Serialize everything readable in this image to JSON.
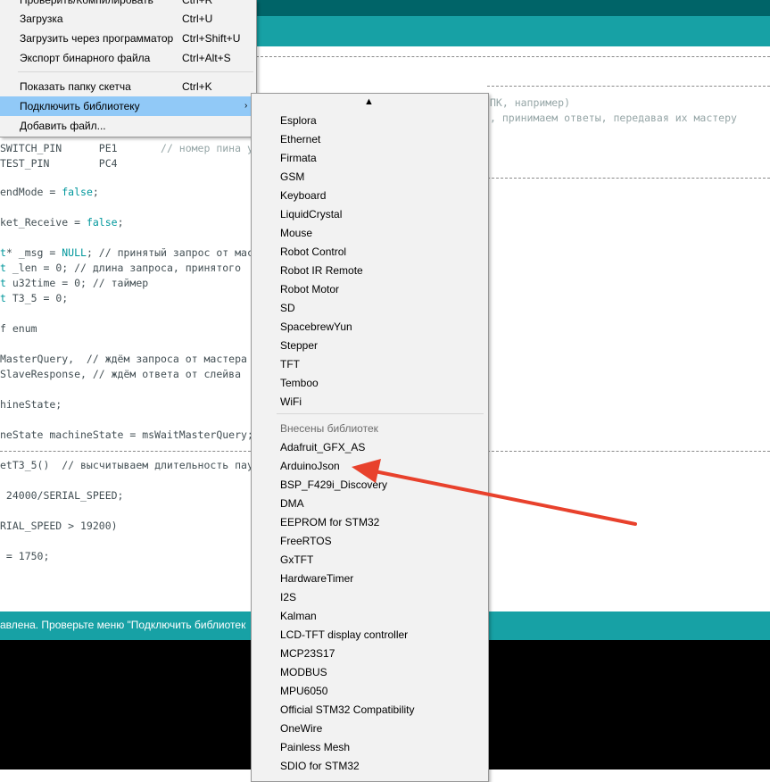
{
  "editor": {
    "lines": [
      [
        "",
        "SWITCH_PIN      PE1       ",
        "",
        "// номер пина у"
      ],
      [
        "",
        "TEST_PIN        PC4",
        "",
        ""
      ],
      [
        "",
        "endMode = ",
        "false",
        ";"
      ],
      [
        "",
        "ket_Receive = ",
        "false",
        ";"
      ],
      [
        "t",
        "* _msg = ",
        "NULL",
        "; // принятый запрос от мас"
      ],
      [
        "t",
        " _len = 0; // длина запроса, принятого",
        "",
        ""
      ],
      [
        "t",
        " u32time = 0; // таймер",
        "",
        ""
      ],
      [
        "t",
        " T3_5 = 0;",
        "",
        ""
      ],
      [
        "",
        "f enum",
        "",
        ""
      ],
      [
        "",
        "MasterQuery,  // ждём запроса от мастера",
        "",
        ""
      ],
      [
        "",
        "SlaveResponse, // ждём ответа от слейва",
        "",
        ""
      ],
      [
        "",
        "hineState;",
        "",
        ""
      ],
      [
        "",
        "neState machineState = msWaitMasterQuery;",
        "",
        ""
      ],
      [
        "",
        "etT3_5()  // высчитываем длительность пау",
        "",
        ""
      ],
      [
        "",
        " 24000/SERIAL_SPEED;",
        "",
        ""
      ],
      [
        "",
        "RIAL_SPEED > 19200)",
        "",
        ""
      ],
      [
        "",
        " = 1750;",
        "",
        ""
      ]
    ],
    "right_comment_1": "ПК, например)",
    "right_comment_2": ", принимаем ответы, передавая их мастеру"
  },
  "status_bar": {
    "text": "авлена. Проверьте меню \"Подключить библиотек"
  },
  "sketch_menu": {
    "items": [
      {
        "label": "Проверить/Компилировать",
        "shortcut": "Ctrl+R"
      },
      {
        "label": "Загрузка",
        "shortcut": "Ctrl+U"
      },
      {
        "label": "Загрузить через программатор",
        "shortcut": "Ctrl+Shift+U"
      },
      {
        "label": "Экспорт бинарного файла",
        "shortcut": "Ctrl+Alt+S"
      },
      {
        "label": "Показать папку скетча",
        "shortcut": "Ctrl+K"
      },
      {
        "label": "Подключить библиотеку",
        "arrow": "›"
      },
      {
        "label": "Добавить файл..."
      }
    ]
  },
  "library_menu": {
    "scroll_up": "▲",
    "builtin": [
      "Esplora",
      "Ethernet",
      "Firmata",
      "GSM",
      "Keyboard",
      "LiquidCrystal",
      "Mouse",
      "Robot Control",
      "Robot IR Remote",
      "Robot Motor",
      "SD",
      "SpacebrewYun",
      "Stepper",
      "TFT",
      "Temboo",
      "WiFi"
    ],
    "contributed_header": "Внесены библиотек",
    "contributed": [
      "Adafruit_GFX_AS",
      "ArduinoJson",
      "BSP_F429i_Discovery",
      "DMA",
      "EEPROM for STM32",
      "FreeRTOS",
      "GxTFT",
      "HardwareTimer",
      "I2S",
      "Kalman",
      "LCD-TFT display controller",
      "MCP23S17",
      "MODBUS",
      "MPU6050",
      "Official STM32 Compatibility",
      "OneWire",
      "Painless Mesh",
      "SDIO for STM32"
    ]
  },
  "colors": {
    "teal_dark": "#006468",
    "teal": "#17a1a5",
    "menu_highlight": "#91c9f7",
    "annotation_arrow": "#e8412c"
  }
}
